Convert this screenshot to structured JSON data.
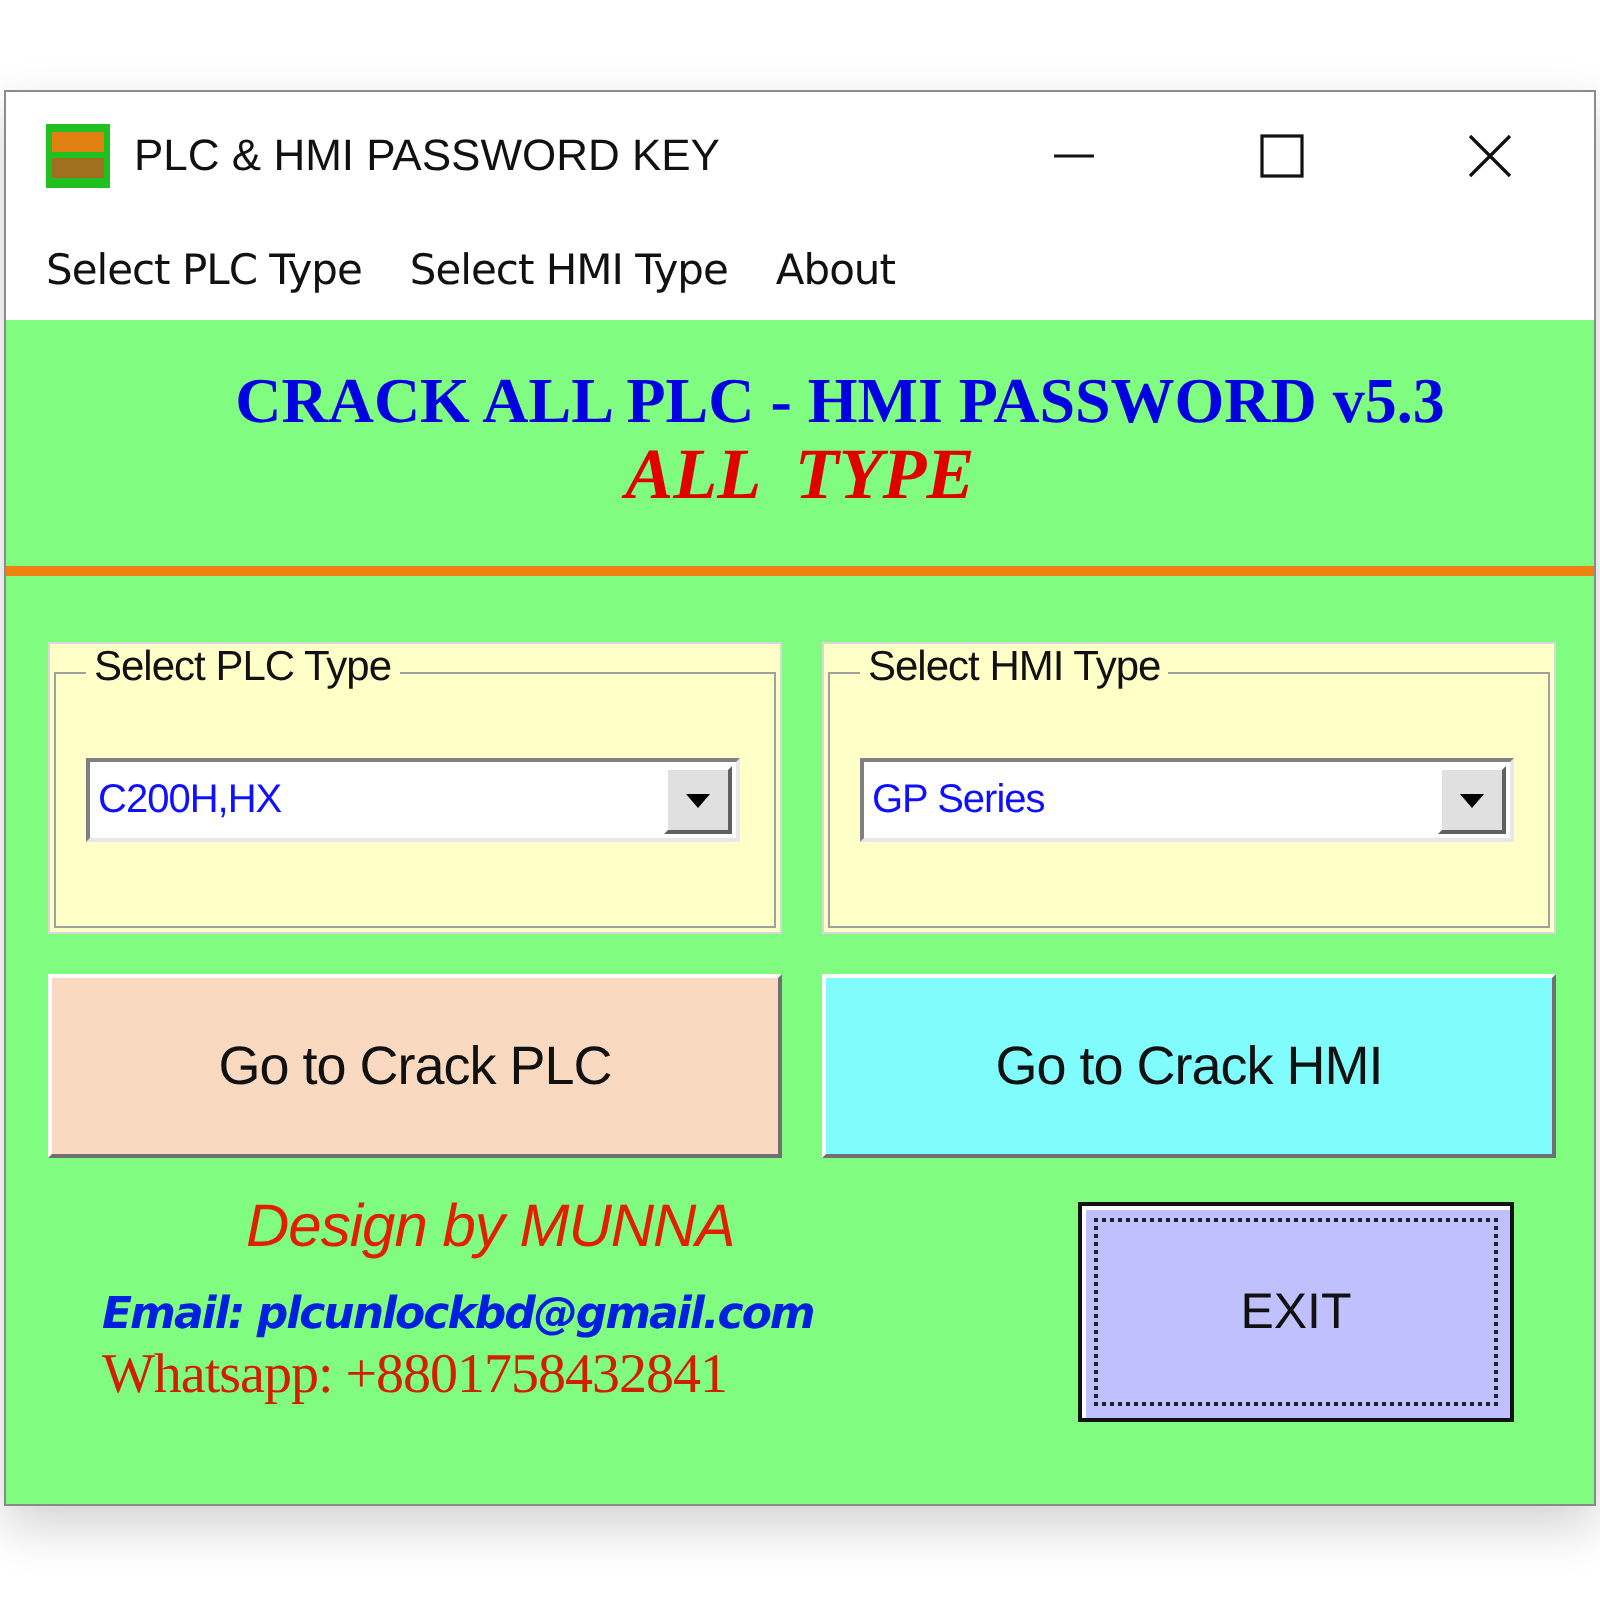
{
  "window": {
    "title": "PLC & HMI PASSWORD KEY"
  },
  "menu": [
    {
      "label": "Select PLC Type"
    },
    {
      "label": "Select HMI Type"
    },
    {
      "label": "About"
    }
  ],
  "header": {
    "title": "CRACK ALL PLC - HMI PASSWORD v5.3",
    "subtitle": "ALL  TYPE"
  },
  "groups": [
    {
      "legend": "Select PLC Type",
      "value": "C200H,HX"
    },
    {
      "legend": "Select HMI Type",
      "value": "GP Series"
    }
  ],
  "actions": [
    {
      "label": "Go to Crack PLC",
      "color": "#f9d9c0"
    },
    {
      "label": "Go to Crack HMI",
      "color": "#80fcfc"
    }
  ],
  "credits": {
    "designer": "Design by MUNNA",
    "email": "Email: plcunlockbd@gmail.com",
    "whatsapp": "Whatsapp: +8801758432841"
  },
  "exit_button": {
    "label": "EXIT",
    "focused": true
  }
}
